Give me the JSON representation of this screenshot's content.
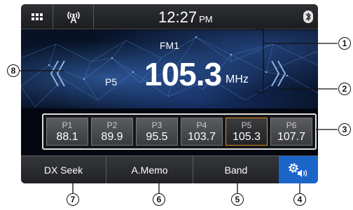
{
  "status_bar": {
    "time": "12:27",
    "am_pm": "PM",
    "icons": [
      "menu-grid-icon",
      "radio-antenna-icon",
      "bluetooth-icon"
    ]
  },
  "tuner": {
    "band": "FM1",
    "preset": "P5",
    "frequency": "105.3",
    "unit": "MHz",
    "seek_icons": [
      "seek-down-icon",
      "seek-up-icon"
    ]
  },
  "presets": [
    {
      "label": "P1",
      "frequency": "88.1"
    },
    {
      "label": "P2",
      "frequency": "89.9"
    },
    {
      "label": "P3",
      "frequency": "95.5"
    },
    {
      "label": "P4",
      "frequency": "103.7"
    },
    {
      "label": "P5",
      "frequency": "105.3"
    },
    {
      "label": "P6",
      "frequency": "107.7"
    }
  ],
  "active_preset": "P5",
  "softkeys": {
    "dx_seek": "DX Seek",
    "a_memo": "A.Memo",
    "band": "Band",
    "settings_icon": "settings-gear-sound-icon"
  },
  "callouts": [
    "1",
    "2",
    "3",
    "4",
    "5",
    "6",
    "7",
    "8"
  ],
  "colors": {
    "active_preset_border": "#e08a1c",
    "settings_button": "#1b65c9"
  }
}
